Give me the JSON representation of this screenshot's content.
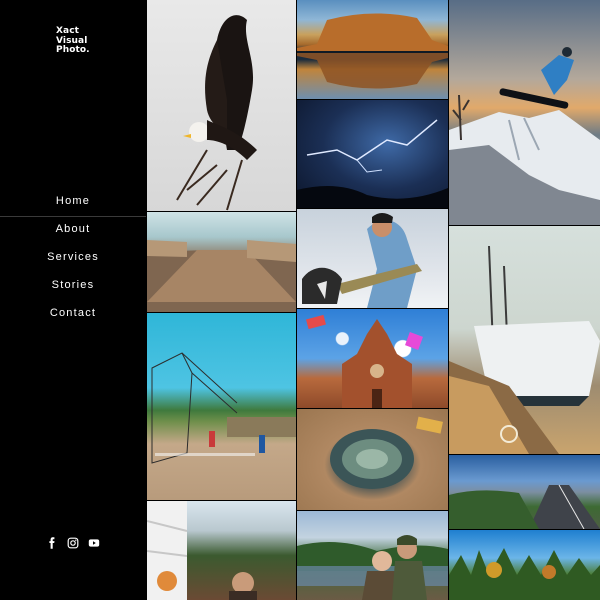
{
  "brand": {
    "line1": "Xact",
    "line2": "Visual",
    "line3": "Photo."
  },
  "nav": {
    "items": [
      {
        "label": "Home",
        "active": true
      },
      {
        "label": "About"
      },
      {
        "label": "Services"
      },
      {
        "label": "Stories"
      },
      {
        "label": "Contact"
      }
    ]
  },
  "social": {
    "icons": [
      "facebook-icon",
      "instagram-icon",
      "youtube-icon"
    ]
  },
  "gallery": {
    "photos": [
      "bald-eagle",
      "mesa-reflection",
      "lightning-storm",
      "snowboard-jump",
      "lake-dock",
      "husky-fish",
      "docked-boat",
      "street-baseball",
      "church-facade",
      "abalone-shell",
      "coastal-road",
      "house-portrait",
      "couple-portrait",
      "forest-autumn"
    ]
  },
  "colors": {
    "background": "#000000",
    "text": "#ffffff",
    "nav_divider": "#3a3a3a"
  }
}
